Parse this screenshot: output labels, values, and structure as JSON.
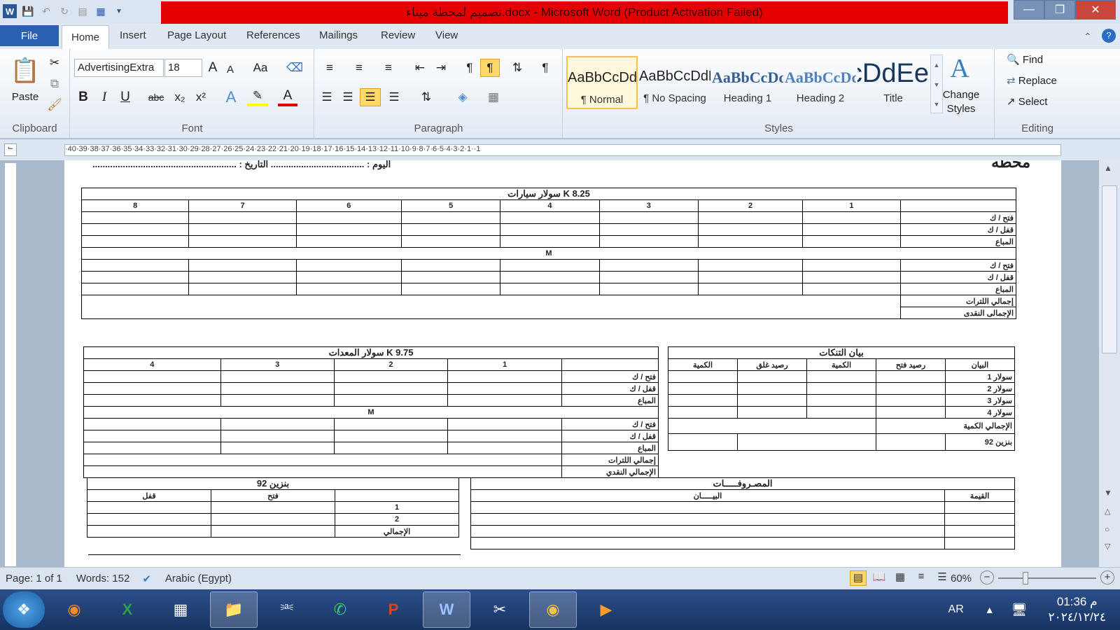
{
  "window": {
    "title": "تصميم لمحطة ميناء.docx - Microsoft Word (Product Activation Failed)"
  },
  "tabs": {
    "file": "File",
    "home": "Home",
    "insert": "Insert",
    "page_layout": "Page Layout",
    "references": "References",
    "mailings": "Mailings",
    "review": "Review",
    "view": "View"
  },
  "clipboard": {
    "paste": "Paste",
    "label": "Clipboard"
  },
  "font": {
    "name": "AdvertisingExtra",
    "size": "18",
    "label": "Font",
    "grow": "A",
    "shrink": "A",
    "case": "Aa",
    "bold": "B",
    "italic": "I",
    "underline": "U",
    "strike": "abc"
  },
  "paragraph": {
    "label": "Paragraph",
    "pilcrow": "¶"
  },
  "styles": {
    "label": "Styles",
    "items": [
      {
        "preview": "AaBbCcDdEe",
        "name": "¶ Normal"
      },
      {
        "preview": "AaBbCcDdEe",
        "name": "¶ No Spacing"
      },
      {
        "preview": "AaBbCcDdEe",
        "name": "Heading 1"
      },
      {
        "preview": "AaBbCcDdEe",
        "name": "Heading 2"
      },
      {
        "preview": "AaBbCcDdEe",
        "name": "Title"
      }
    ],
    "change": "Change Styles",
    "change_glyph": "A"
  },
  "editing": {
    "label": "Editing",
    "find": "Find",
    "replace": "Replace",
    "select": "Select"
  },
  "ruler": {
    "ticks": "·40·39·38·37·36·35·34·33·32·31·30·29·28·27·26·25·24·23·22·21·20·19·18·17·16·15·14·13·12·11·10·9·8·7·6·5·4·3·2·1··1"
  },
  "doc": {
    "station": "محطه",
    "date_line": "اليوم : ..................................... التاريخ : .........................................................",
    "t1": {
      "title": "سولار سيارات K 8.25",
      "cols": [
        "8",
        "7",
        "6",
        "5",
        "4",
        "3",
        "2",
        "1"
      ],
      "rows": [
        "فتح / ك",
        "قفل / ك",
        "المباع"
      ],
      "mid": "M",
      "total_liters": "إجمالي اللترات",
      "total_cash": "الإجمالى النقدى"
    },
    "t2": {
      "title": "سولار المعدات K 9.75",
      "cols": [
        "4",
        "3",
        "2",
        "1"
      ],
      "rows": [
        "فتح / ك",
        "قفل / ك",
        "المباع"
      ],
      "mid": "M",
      "total_liters": "إجمالي اللترات",
      "total_cash": "الإجمالي النقدي"
    },
    "t3": {
      "title": "بيان التنكات",
      "headers": [
        "البيان",
        "رصيد فتح",
        "الكمية",
        "رصيد غلق",
        "الكمية"
      ],
      "rows": [
        "سولار 1",
        "سولار 2",
        "سولار 3",
        "سولار 4"
      ],
      "total": "الإجمالي الكمية",
      "petrol": "بنزين 92"
    },
    "t4": {
      "title": "بنزين 92",
      "headers": [
        "",
        "فتح",
        "قفل"
      ],
      "rows": [
        "1",
        "2",
        "الإجمالي"
      ]
    },
    "t5": {
      "title": "المصـروفـــــات",
      "headers": [
        "القيمة",
        "البيـــــان"
      ]
    }
  },
  "status": {
    "page": "Page: 1 of 1",
    "words": "Words: 152",
    "lang": "Arabic (Egypt)",
    "zoom": "60%",
    "zoom_level": 0.6
  },
  "taskbar": {
    "lang": "AR",
    "time": "01:36 م",
    "date": "٢٠٢٤/١٢/٢٤"
  }
}
